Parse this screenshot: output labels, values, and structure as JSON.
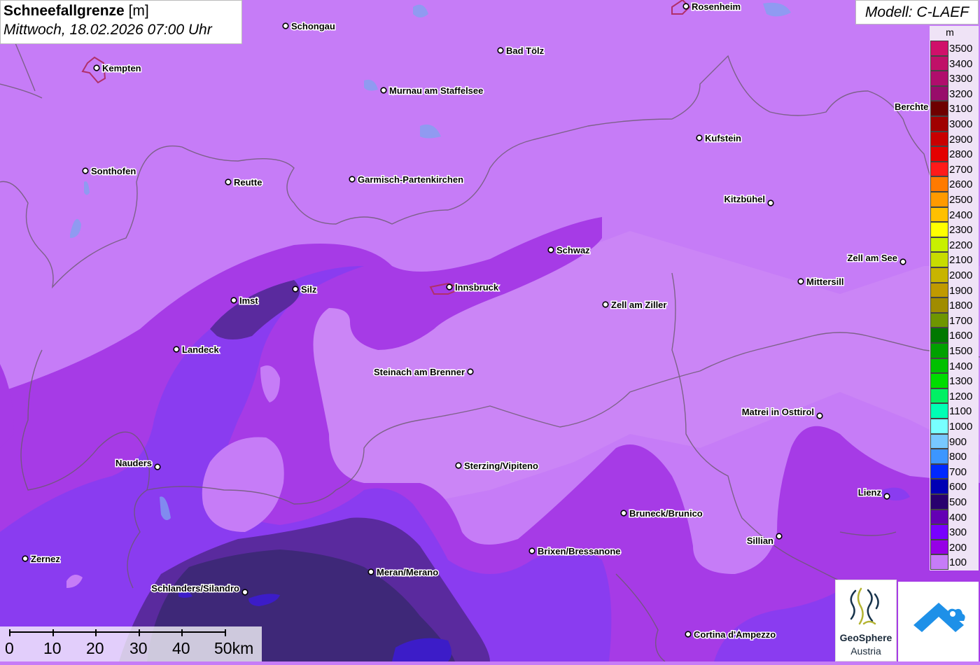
{
  "title": {
    "parameter": "Schneefallgrenze",
    "unit": "[m]",
    "datetime": "Mittwoch, 18.02.2026 07:00 Uhr"
  },
  "model_label": "Modell: C-LAEF",
  "legend": {
    "unit": "m",
    "entries": [
      {
        "label": "3500",
        "color": "#d0106a"
      },
      {
        "label": "3400",
        "color": "#c01068"
      },
      {
        "label": "3300",
        "color": "#b00d6c"
      },
      {
        "label": "3200",
        "color": "#980c6a"
      },
      {
        "label": "3100",
        "color": "#6e0000"
      },
      {
        "label": "3000",
        "color": "#a00000"
      },
      {
        "label": "2900",
        "color": "#c80000"
      },
      {
        "label": "2800",
        "color": "#e40000"
      },
      {
        "label": "2700",
        "color": "#ff1a1a"
      },
      {
        "label": "2600",
        "color": "#ff7a00"
      },
      {
        "label": "2500",
        "color": "#ff9a00"
      },
      {
        "label": "2400",
        "color": "#ffc000"
      },
      {
        "label": "2300",
        "color": "#ffff00"
      },
      {
        "label": "2200",
        "color": "#c8f000"
      },
      {
        "label": "2100",
        "color": "#c8dc00"
      },
      {
        "label": "2000",
        "color": "#c8b400"
      },
      {
        "label": "1900",
        "color": "#c09a00"
      },
      {
        "label": "1800",
        "color": "#a08c00"
      },
      {
        "label": "1700",
        "color": "#6e9600"
      },
      {
        "label": "1600",
        "color": "#007800"
      },
      {
        "label": "1500",
        "color": "#00a000"
      },
      {
        "label": "1400",
        "color": "#00c000"
      },
      {
        "label": "1300",
        "color": "#00dc00"
      },
      {
        "label": "1200",
        "color": "#00f064"
      },
      {
        "label": "1100",
        "color": "#00ffb4"
      },
      {
        "label": "1000",
        "color": "#78ffff"
      },
      {
        "label": "900",
        "color": "#78c8ff"
      },
      {
        "label": "800",
        "color": "#3c96ff"
      },
      {
        "label": "700",
        "color": "#0028ff"
      },
      {
        "label": "600",
        "color": "#0000b4"
      },
      {
        "label": "500",
        "color": "#28006e"
      },
      {
        "label": "400",
        "color": "#6400b4"
      },
      {
        "label": "300",
        "color": "#7800ff"
      },
      {
        "label": "200",
        "color": "#9600e6"
      },
      {
        "label": "100",
        "color": "#c67cf7"
      }
    ]
  },
  "cities": [
    {
      "name": "Rosenheim"
    },
    {
      "name": "Schongau"
    },
    {
      "name": "Kempten"
    },
    {
      "name": "Bad Tölz"
    },
    {
      "name": "Murnau am Staffelsee"
    },
    {
      "name": "Berchte"
    },
    {
      "name": "Kufstein"
    },
    {
      "name": "Sonthofen"
    },
    {
      "name": "Reutte"
    },
    {
      "name": "Garmisch-Partenkirchen"
    },
    {
      "name": "Kitzbühel"
    },
    {
      "name": "Schwaz"
    },
    {
      "name": "Zell am See"
    },
    {
      "name": "Mittersill"
    },
    {
      "name": "Silz"
    },
    {
      "name": "Innsbruck"
    },
    {
      "name": "Imst"
    },
    {
      "name": "Zell am Ziller"
    },
    {
      "name": "Landeck"
    },
    {
      "name": "Steinach am Brenner"
    },
    {
      "name": "Matrei in Osttirol"
    },
    {
      "name": "Nauders"
    },
    {
      "name": "Sterzing/Vipiteno"
    },
    {
      "name": "Lienz"
    },
    {
      "name": "Bruneck/Brunico"
    },
    {
      "name": "Sillian"
    },
    {
      "name": "Brixen/Bressanone"
    },
    {
      "name": "Zernez"
    },
    {
      "name": "Meran/Merano"
    },
    {
      "name": "Schlanders/Silandro"
    },
    {
      "name": "Cortina d'Ampezzo"
    }
  ],
  "scale_bar": {
    "labels": [
      "0",
      "10",
      "20",
      "30",
      "40",
      "50km"
    ]
  },
  "logos": {
    "geosphere_name": "GeoSphere",
    "geosphere_country": "Austria"
  }
}
